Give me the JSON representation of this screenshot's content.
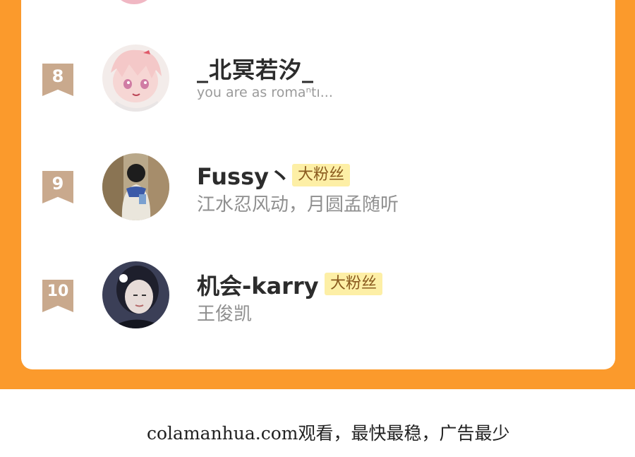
{
  "ranking": [
    {
      "rank": "8",
      "name": "_北冥若汐_",
      "subtitle": "you are as romaⁿtı...",
      "badge": ""
    },
    {
      "rank": "9",
      "name": "Fussy丶",
      "subtitle": "江水忍风动，月圆孟随听",
      "badge": "大粉丝"
    },
    {
      "rank": "10",
      "name": "机会-karry",
      "subtitle": "王俊凯",
      "badge": "大粉丝"
    }
  ],
  "footer": {
    "text": "colamanhua.com观看，最快最稳，广告最少"
  },
  "colors": {
    "accent_orange": "#FB9A2C",
    "rank_badge": "#C9A98D",
    "fan_badge_bg": "#FDEFA6"
  }
}
